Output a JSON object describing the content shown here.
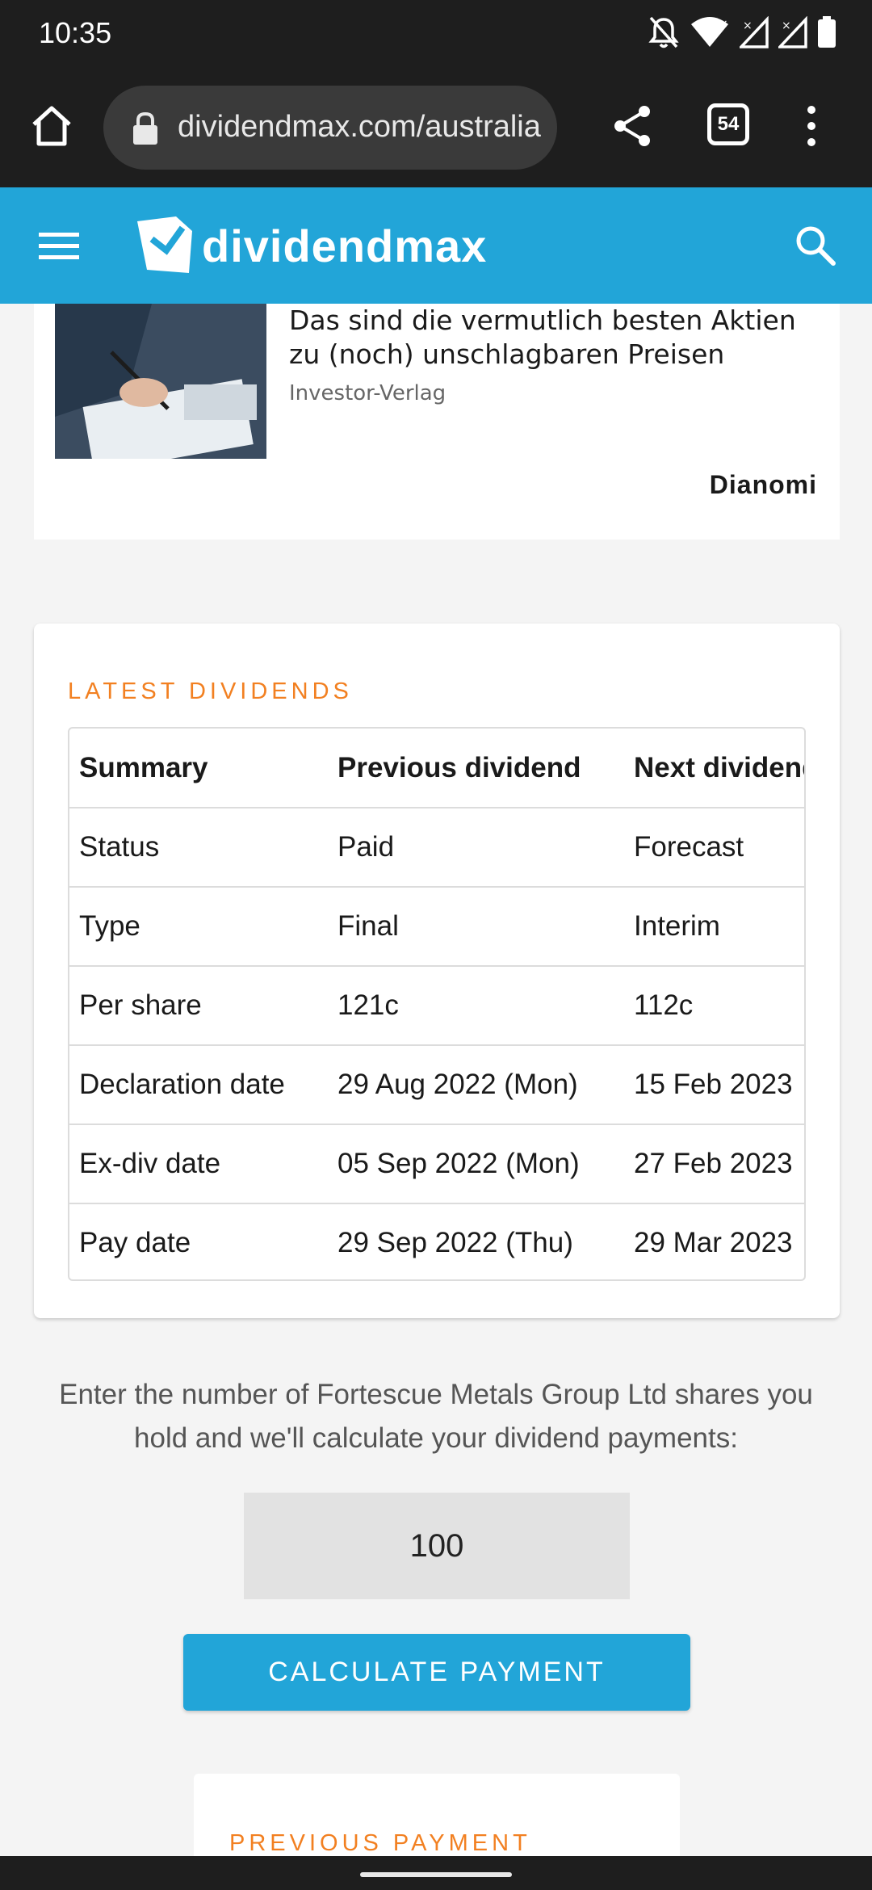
{
  "status_bar": {
    "time": "10:35",
    "icons": [
      "bell-off-icon",
      "wifi-icon",
      "signal-icon",
      "signal-icon",
      "battery-icon"
    ]
  },
  "browser": {
    "url": "dividendmax.com/australia",
    "tab_count": "54"
  },
  "site": {
    "logo_text": "dividendmax",
    "accent_color": "#22a5d8"
  },
  "ad": {
    "title": "Das sind die vermutlich besten Aktien zu (noch) unschlagbaren Preisen",
    "source": "Investor-Verlag",
    "brand": "Dianomi"
  },
  "latest_dividends": {
    "heading": "LATEST DIVIDENDS",
    "headers": [
      "Summary",
      "Previous dividend",
      "Next dividend"
    ],
    "rows": [
      [
        "Status",
        "Paid",
        "Forecast"
      ],
      [
        "Type",
        "Final",
        "Interim"
      ],
      [
        "Per share",
        "121c",
        "112c"
      ],
      [
        "Declaration date",
        "29 Aug 2022 (Mon)",
        "15 Feb 2023"
      ],
      [
        "Ex-div date",
        "05 Sep 2022 (Mon)",
        "27 Feb 2023"
      ],
      [
        "Pay date",
        "29 Sep 2022 (Thu)",
        "29 Mar 2023"
      ]
    ]
  },
  "calculator": {
    "intro": "Enter the number of Fortescue Metals Group Ltd shares you hold and we'll calculate your dividend payments:",
    "shares_value": "100",
    "button_label": "CALCULATE PAYMENT"
  },
  "previous_payment": {
    "heading": "PREVIOUS PAYMENT"
  }
}
